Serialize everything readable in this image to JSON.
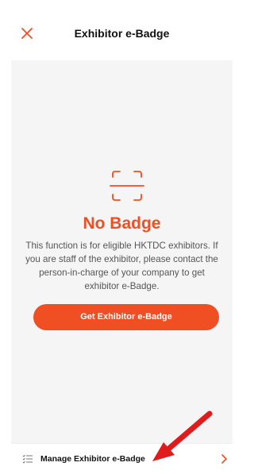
{
  "header": {
    "title": "Exhibitor e-Badge",
    "close_icon": "close-icon"
  },
  "main": {
    "badge_icon": "scan-frame-icon",
    "heading": "No Badge",
    "description": "This function is for eligible HKTDC exhibitors. If you are staff of the exhibitor, please contact the person-in-charge of your company to get exhibitor e-Badge.",
    "button_label": "Get Exhibitor e-Badge"
  },
  "footer": {
    "list_icon": "list-icon",
    "label": "Manage Exhibitor e-Badge",
    "chevron_icon": "chevron-right-icon"
  },
  "annotation": {
    "arrow_icon": "red-arrow-annotation"
  },
  "colors": {
    "accent": "#f04e23",
    "background": "#f5f5f5",
    "text_dark": "#111111",
    "text_muted": "#555555"
  }
}
